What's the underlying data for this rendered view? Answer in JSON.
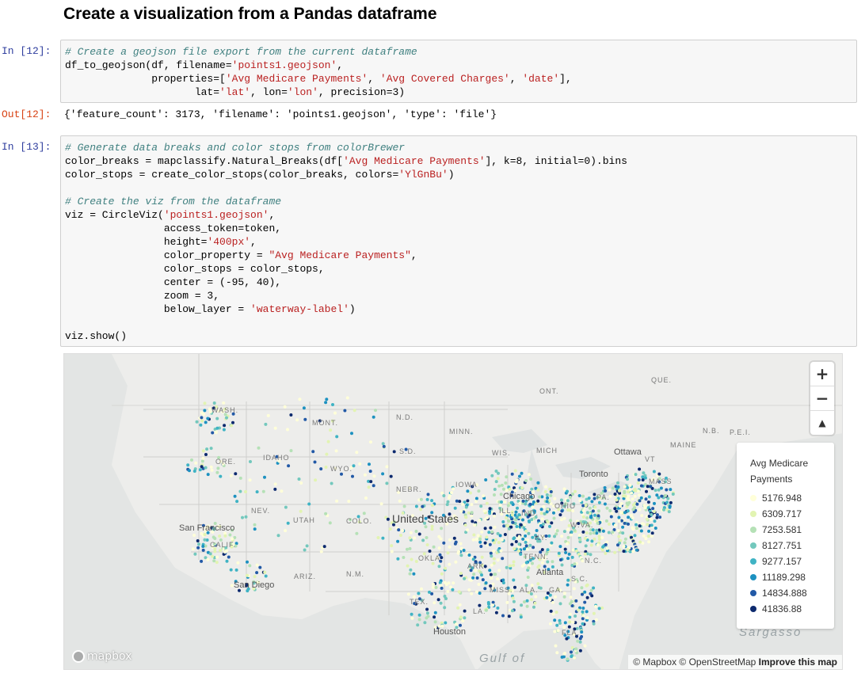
{
  "heading": "Create a visualization from a Pandas dataframe",
  "cell12": {
    "prompt_in": "In [12]:",
    "prompt_out": "Out[12]:",
    "lines": [
      [
        {
          "t": "# Create a geojson file export from the current dataframe",
          "c": "cm"
        }
      ],
      [
        {
          "t": "df_to_geojson(df, filename="
        },
        {
          "t": "'points1.geojson'",
          "c": "str"
        },
        {
          "t": ","
        }
      ],
      [
        {
          "t": "              properties=["
        },
        {
          "t": "'Avg Medicare Payments'",
          "c": "str"
        },
        {
          "t": ", "
        },
        {
          "t": "'Avg Covered Charges'",
          "c": "str"
        },
        {
          "t": ", "
        },
        {
          "t": "'date'",
          "c": "str"
        },
        {
          "t": "],"
        }
      ],
      [
        {
          "t": "                     lat="
        },
        {
          "t": "'lat'",
          "c": "str"
        },
        {
          "t": ", lon="
        },
        {
          "t": "'lon'",
          "c": "str"
        },
        {
          "t": ", precision=3)"
        }
      ]
    ],
    "output": "{'feature_count': 3173, 'filename': 'points1.geojson', 'type': 'file'}"
  },
  "cell13": {
    "prompt_in": "In [13]:",
    "lines": [
      [
        {
          "t": "# Generate data breaks and color stops from colorBrewer",
          "c": "cm"
        }
      ],
      [
        {
          "t": "color_breaks = mapclassify.Natural_Breaks(df["
        },
        {
          "t": "'Avg Medicare Payments'",
          "c": "str"
        },
        {
          "t": "], k=8, initial=0).bins"
        }
      ],
      [
        {
          "t": "color_stops = create_color_stops(color_breaks, colors="
        },
        {
          "t": "'YlGnBu'",
          "c": "str"
        },
        {
          "t": ")"
        }
      ],
      [
        {
          "t": ""
        }
      ],
      [
        {
          "t": "# Create the viz from the dataframe",
          "c": "cm"
        }
      ],
      [
        {
          "t": "viz = CircleViz("
        },
        {
          "t": "'points1.geojson'",
          "c": "str"
        },
        {
          "t": ","
        }
      ],
      [
        {
          "t": "                access_token=token,"
        }
      ],
      [
        {
          "t": "                height="
        },
        {
          "t": "'400px'",
          "c": "str"
        },
        {
          "t": ","
        }
      ],
      [
        {
          "t": "                color_property = "
        },
        {
          "t": "\"Avg Medicare Payments\"",
          "c": "str"
        },
        {
          "t": ","
        }
      ],
      [
        {
          "t": "                color_stops = color_stops,"
        }
      ],
      [
        {
          "t": "                center = (-95, 40),"
        }
      ],
      [
        {
          "t": "                zoom = 3,"
        }
      ],
      [
        {
          "t": "                below_layer = "
        },
        {
          "t": "'waterway-label'",
          "c": "str"
        },
        {
          "t": ")"
        }
      ],
      [
        {
          "t": ""
        }
      ],
      [
        {
          "t": "viz.show()"
        }
      ]
    ]
  },
  "map": {
    "controls": {
      "zoom_in": "+",
      "zoom_out": "−",
      "compass": "▲"
    },
    "legend": {
      "title": "Avg Medicare Payments",
      "items": [
        {
          "label": "5176.948",
          "color": "#ffffd9"
        },
        {
          "label": "6309.717",
          "color": "#e2f4b2"
        },
        {
          "label": "7253.581",
          "color": "#b5e1b6"
        },
        {
          "label": "8127.751",
          "color": "#73c8bd"
        },
        {
          "label": "9277.157",
          "color": "#3fb3c4"
        },
        {
          "label": "11189.298",
          "color": "#1d91c0"
        },
        {
          "label": "14834.888",
          "color": "#2259a6"
        },
        {
          "label": "41836.88",
          "color": "#0d2a6e"
        }
      ]
    },
    "labels": {
      "country": "United States",
      "states": [
        "WASH.",
        "MONT.",
        "N.D.",
        "MINN.",
        "ORE.",
        "IDAHO",
        "WYO.",
        "S.D.",
        "WIS.",
        "MICH",
        "NEBR.",
        "IOWA",
        "NEV.",
        "UTAH",
        "COLO.",
        "ILL.",
        "IND.",
        "OHIO",
        "PA.",
        "CALIF.",
        "KY.",
        "W.VA.",
        "ARIZ.",
        "N.M.",
        "OKLA.",
        "ARK.",
        "TENN.",
        "N.C.",
        "S.C.",
        "TEX.",
        "MISS.",
        "ALA.",
        "GA.",
        "LA.",
        "FLA.",
        "MASS",
        "MAINE",
        "N.B.",
        "P.E.I.",
        "ONT.",
        "QUE.",
        "VT"
      ],
      "cities": [
        "Ottawa",
        "Toronto",
        "Chicago",
        "San Francisco",
        "San Diego",
        "Atlanta",
        "Houston"
      ],
      "water": [
        "Sargasso",
        "Gulf of"
      ]
    },
    "logo": "mapbox",
    "attribution": {
      "text": "© Mapbox © OpenStreetMap",
      "link": "Improve this map"
    }
  }
}
